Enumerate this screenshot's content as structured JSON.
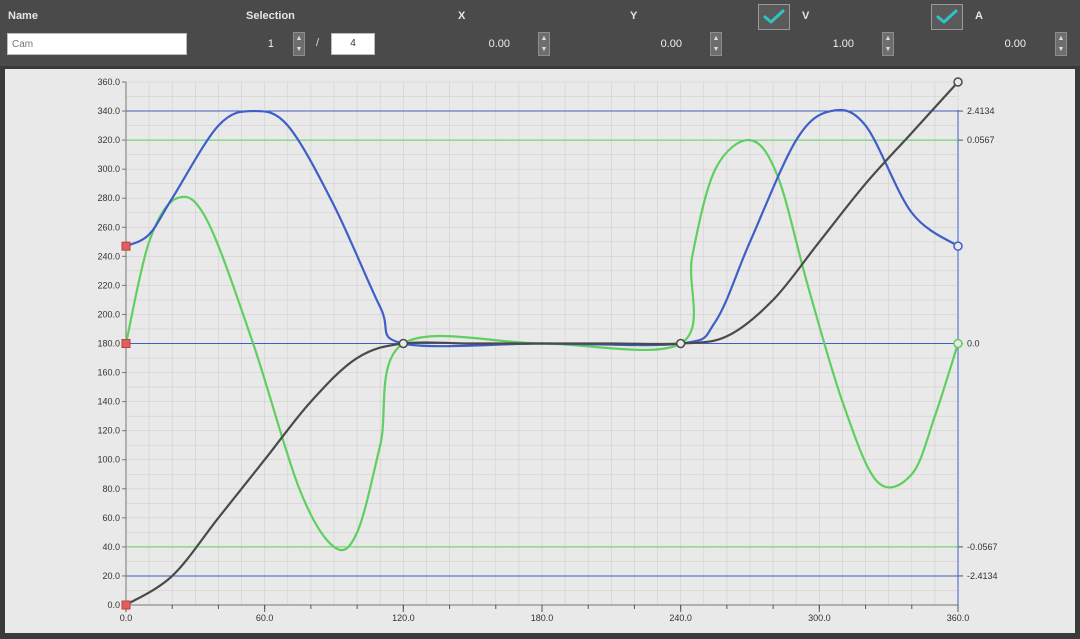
{
  "toolbar": {
    "name_label": "Name",
    "name_placeholder": "Cam",
    "selection_label": "Selection",
    "selection_index": "1",
    "selection_count": "4",
    "selection_separator": "/",
    "x_label": "X",
    "x_value": "0.00",
    "y_label": "Y",
    "y_value": "0.00",
    "v_label": "V",
    "v_checked": true,
    "v_value": "1.00",
    "a_label": "A",
    "a_checked": true,
    "a_value": "0.00"
  },
  "colors": {
    "position": "#4a4a4a",
    "velocity": "#3f5fc8",
    "acceleration": "#5fcf5f",
    "grid": "#d0d0d0",
    "check": "#2fc4c4",
    "marker_start": "#e06060"
  },
  "chart_data": {
    "type": "line",
    "title": "",
    "xlim": [
      0,
      360
    ],
    "ylim": [
      0,
      360
    ],
    "x_ticks": [
      "0.0",
      "60.0",
      "120.0",
      "180.0",
      "240.0",
      "300.0",
      "360.0"
    ],
    "y_ticks": [
      "0.0",
      "20.0",
      "40.0",
      "60.0",
      "80.0",
      "100.0",
      "120.0",
      "140.0",
      "160.0",
      "180.0",
      "200.0",
      "220.0",
      "240.0",
      "260.0",
      "280.0",
      "300.0",
      "320.0",
      "340.0",
      "360.0"
    ],
    "right_labels": [
      {
        "value": 340,
        "text": "2.4134"
      },
      {
        "value": 320,
        "text": "0.0567"
      },
      {
        "value": 180,
        "text": "0.0"
      },
      {
        "value": 40,
        "text": "-0.0567"
      },
      {
        "value": 20,
        "text": "-2.4134"
      }
    ],
    "reference_lines": [
      {
        "series": "velocity",
        "y": 340
      },
      {
        "series": "velocity",
        "y": 180
      },
      {
        "series": "velocity",
        "y": 20
      },
      {
        "series": "acceleration",
        "y": 320
      },
      {
        "series": "acceleration",
        "y": 40
      }
    ],
    "series": [
      {
        "key": "position",
        "x": [
          0,
          20,
          40,
          60,
          80,
          100,
          120,
          150,
          180,
          210,
          240,
          260,
          280,
          300,
          320,
          340,
          360
        ],
        "y": [
          0,
          20,
          60,
          100,
          140,
          170,
          180,
          180,
          180,
          180,
          180,
          185,
          210,
          250,
          290,
          325,
          360
        ]
      },
      {
        "key": "velocity",
        "x": [
          0,
          10,
          20,
          40,
          55,
          70,
          90,
          110,
          120,
          180,
          240,
          255,
          270,
          290,
          305,
          320,
          340,
          360
        ],
        "y": [
          247,
          255,
          280,
          330,
          340,
          330,
          275,
          205,
          180,
          180,
          180,
          195,
          250,
          320,
          340,
          330,
          270,
          247
        ]
      },
      {
        "key": "acceleration",
        "x": [
          0,
          10,
          22,
          35,
          55,
          75,
          90,
          100,
          110,
          120,
          180,
          240,
          245,
          255,
          270,
          282,
          295,
          310,
          325,
          340,
          350,
          360
        ],
        "y": [
          180,
          250,
          280,
          265,
          180,
          80,
          40,
          50,
          110,
          180,
          180,
          180,
          240,
          300,
          320,
          295,
          220,
          140,
          85,
          90,
          130,
          180
        ]
      }
    ],
    "markers": [
      {
        "series": "position",
        "x": 0,
        "y": 0,
        "color": "start"
      },
      {
        "series": "velocity",
        "x": 0,
        "y": 247,
        "color": "start"
      },
      {
        "series": "acceleration",
        "x": 0,
        "y": 180,
        "color": "start"
      },
      {
        "series": "position",
        "x": 120,
        "y": 180,
        "color": "position"
      },
      {
        "series": "position",
        "x": 240,
        "y": 180,
        "color": "position"
      },
      {
        "series": "position",
        "x": 360,
        "y": 360,
        "color": "position"
      },
      {
        "series": "velocity",
        "x": 360,
        "y": 247,
        "color": "velocity"
      },
      {
        "series": "acceleration",
        "x": 360,
        "y": 180,
        "color": "acceleration"
      }
    ]
  }
}
